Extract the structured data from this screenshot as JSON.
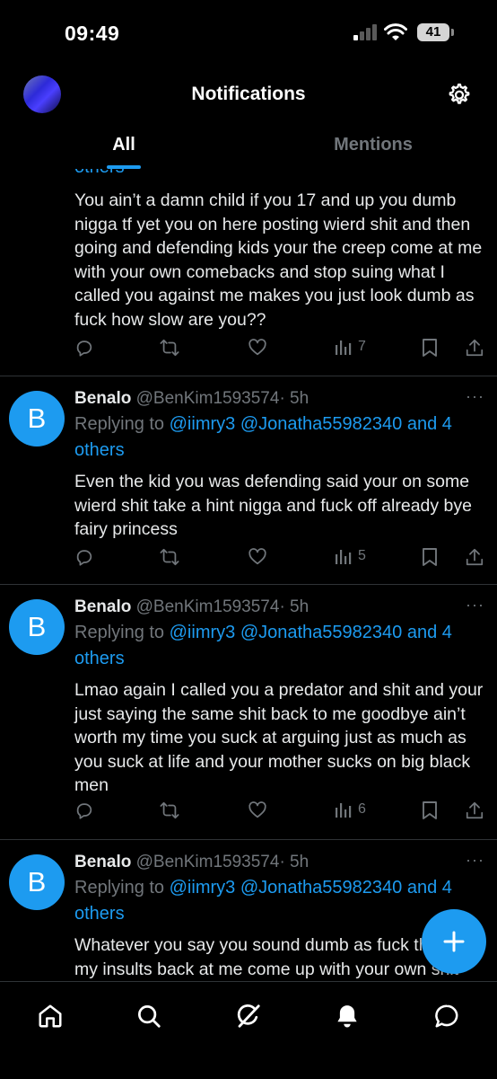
{
  "status_bar": {
    "time": "09:49",
    "battery": "41"
  },
  "header": {
    "title": "Notifications"
  },
  "tabs": [
    {
      "label": "All",
      "active": true
    },
    {
      "label": "Mentions",
      "active": false
    }
  ],
  "colors": {
    "accent": "#1d9bf0",
    "background": "#000000",
    "muted": "#71767b",
    "text": "#e7e9ea",
    "divider": "#2f3336"
  },
  "tweets": [
    {
      "partial_reply": "others",
      "text": "You ain’t a damn  child if you 17 and up you dumb nigga tf yet you on here posting wierd shit and then going and defending kids your the creep come at me with your own comebacks and stop suing what I called you against me makes you just look dumb as fuck how slow are you??",
      "views": "7"
    },
    {
      "avatar": "B",
      "name": "Benalo",
      "handle": "@BenKim1593574",
      "time": "· 5h",
      "more": "···",
      "replying_prefix": "Replying to ",
      "replying_to": "@iimry3 @Jonatha55982340 and 4 others",
      "text": "Even the kid you was defending said your on some wierd shit take a hint nigga and fuck off already bye fairy princess",
      "views": "5"
    },
    {
      "avatar": "B",
      "name": "Benalo",
      "handle": "@BenKim1593574",
      "time": "· 5h",
      "more": "···",
      "replying_prefix": "Replying to ",
      "replying_to": "@iimry3 @Jonatha55982340 and 4 others",
      "text": "Lmao again I called you a predator and shit and your just saying the same shit back to me goodbye ain’t worth my time you suck at arguing just as much as you suck at life and your mother sucks on big black men",
      "views": "6"
    },
    {
      "avatar": "B",
      "name": "Benalo",
      "handle": "@BenKim1593574",
      "time": "· 5h",
      "more": "···",
      "replying_prefix": "Replying to ",
      "replying_to": "@iimry3 @Jonatha55982340 and 4 others",
      "text": "Whatever you say you sound dumb as fuck throwing my insults back at me come up with your own shit"
    }
  ],
  "icons": {
    "tweet_actions": [
      "reply-icon",
      "retweet-icon",
      "like-icon",
      "views-icon",
      "bookmark-icon",
      "share-icon"
    ],
    "bottom_nav": [
      "home-icon",
      "search-icon",
      "grok-icon",
      "notifications-bell-icon",
      "messages-icon"
    ],
    "fab": "plus-icon"
  }
}
